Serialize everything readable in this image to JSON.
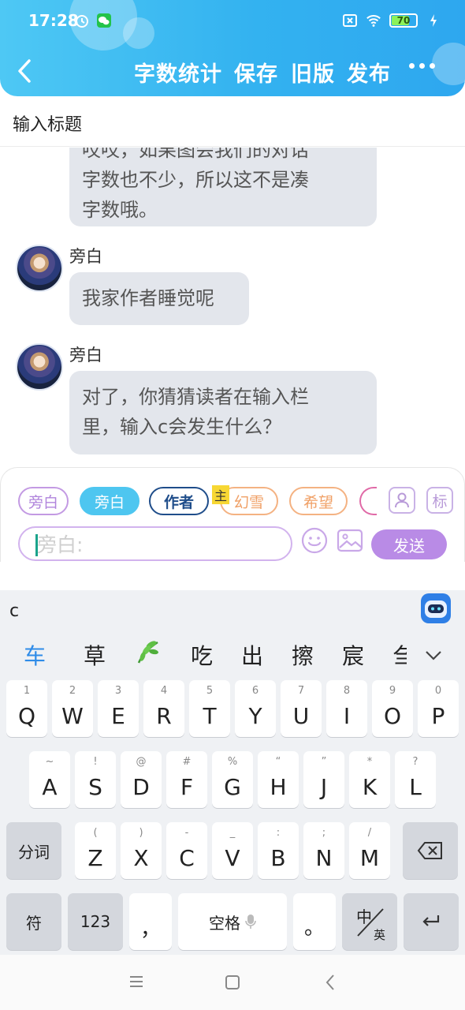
{
  "status_bar": {
    "time": "17:28",
    "battery": "70"
  },
  "header": {
    "back_icon": "chevron-left-icon",
    "menu": [
      "字数统计",
      "保存",
      "旧版",
      "发布"
    ],
    "more_icon": "more-dots-icon"
  },
  "title_input": {
    "placeholder": "输入标题"
  },
  "chat": {
    "partial_message_lines": [
      "哎哎，如果图会我们的对话",
      "字数也不少，所以这不是凑",
      "字数哦。"
    ],
    "messages": [
      {
        "speaker": "旁白",
        "lines": [
          "我家作者睡觉呢"
        ]
      },
      {
        "speaker": "旁白",
        "lines": [
          "对了，你猜猜读者在输入栏",
          "里，输入c会发生什么？"
        ]
      }
    ]
  },
  "compose": {
    "chips": [
      "旁白",
      "旁白",
      "作者",
      "幻雪",
      "希望"
    ],
    "main_tag": "主",
    "mark_button": "标",
    "input_placeholder": "旁白:",
    "send_label": "发送"
  },
  "keyboard": {
    "composing_text": "c",
    "candidates": [
      "车",
      "草",
      "吃",
      "出",
      "擦",
      "宸",
      "刍"
    ],
    "row1": [
      {
        "num": "1",
        "key": "Q"
      },
      {
        "num": "2",
        "key": "W"
      },
      {
        "num": "3",
        "key": "E"
      },
      {
        "num": "4",
        "key": "R"
      },
      {
        "num": "5",
        "key": "T"
      },
      {
        "num": "6",
        "key": "Y"
      },
      {
        "num": "7",
        "key": "U"
      },
      {
        "num": "8",
        "key": "I"
      },
      {
        "num": "9",
        "key": "O"
      },
      {
        "num": "0",
        "key": "P"
      }
    ],
    "row2": [
      {
        "sym": "~",
        "key": "A"
      },
      {
        "sym": "!",
        "key": "S"
      },
      {
        "sym": "@",
        "key": "D"
      },
      {
        "sym": "#",
        "key": "F"
      },
      {
        "sym": "%",
        "key": "G"
      },
      {
        "sym": "“",
        "key": "H"
      },
      {
        "sym": "”",
        "key": "J"
      },
      {
        "sym": "*",
        "key": "K"
      },
      {
        "sym": "?",
        "key": "L"
      }
    ],
    "row3": [
      {
        "sym": "(",
        "key": "Z"
      },
      {
        "sym": ")",
        "key": "X"
      },
      {
        "sym": "-",
        "key": "C"
      },
      {
        "sym": "_",
        "key": "V"
      },
      {
        "sym": ":",
        "key": "B"
      },
      {
        "sym": ";",
        "key": "N"
      },
      {
        "sym": "/",
        "key": "M"
      }
    ],
    "fenci": "分词",
    "fu": "符",
    "num_key": "123",
    "comma": "，",
    "space": "空格",
    "period": "。",
    "lang_top": "中",
    "lang_bottom": "英"
  }
}
